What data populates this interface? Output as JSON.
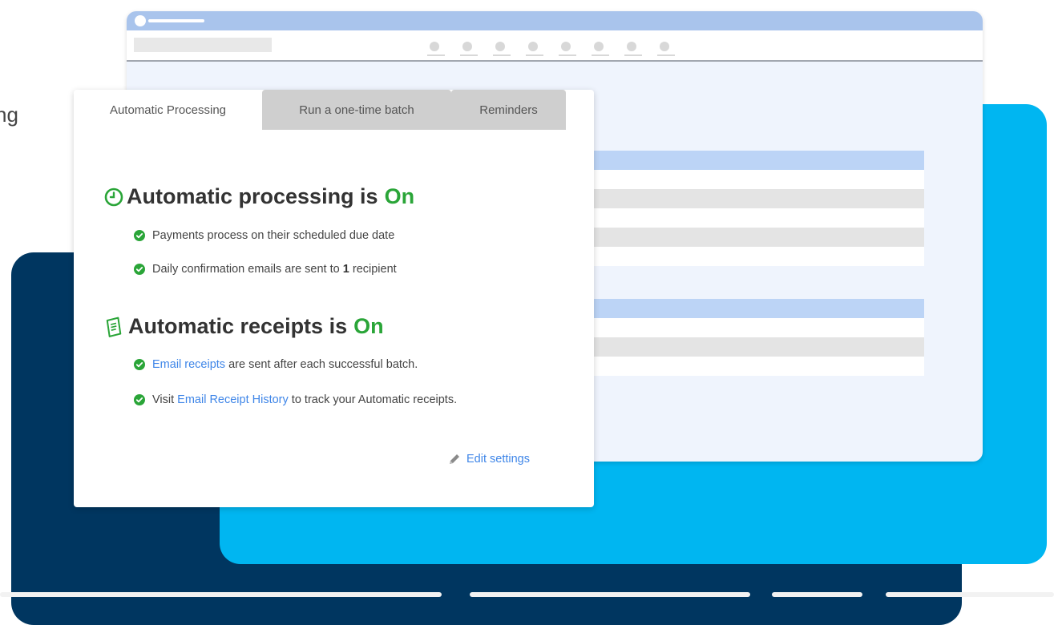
{
  "edge_text": "ng",
  "tabs": [
    {
      "label": "Automatic Processing",
      "active": true
    },
    {
      "label": "Run a one-time batch",
      "active": false
    },
    {
      "label": "Reminders",
      "active": false
    }
  ],
  "processing": {
    "title": "Automatic processing is",
    "status": "On",
    "icon": "clock-icon",
    "items": [
      {
        "text": "Payments process on their scheduled due date"
      },
      {
        "text_before": "Daily confirmation emails are sent to",
        "count": "1",
        "text_after": "recipient"
      }
    ]
  },
  "receipts": {
    "title": "Automatic receipts is",
    "status": "On",
    "icon": "receipt-icon",
    "items": [
      {
        "link": "Email receipts",
        "text_after": "are sent after each successful batch."
      },
      {
        "text_before": "Visit",
        "link": "Email Receipt History",
        "text_after": "to track your Automatic receipts."
      }
    ]
  },
  "edit_label": "Edit settings",
  "colors": {
    "accent_green": "#2aa538",
    "link_blue": "#3f86e8",
    "dark_navy": "#003660",
    "bright_blue": "#00b6f1",
    "table_header": "#bcd4f6"
  }
}
